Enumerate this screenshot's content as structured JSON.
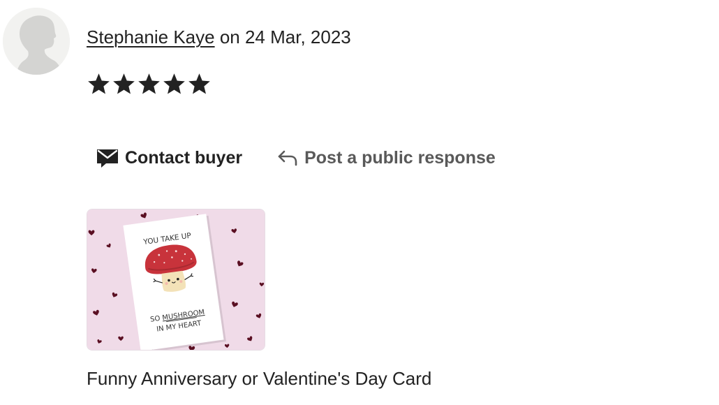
{
  "review": {
    "avatar_icon": "default-avatar-silhouette-icon",
    "reviewer_name": "Stephanie Kaye",
    "date_prefix": " on ",
    "date": "24 Mar, 2023",
    "rating": 5,
    "max_rating": 5,
    "star_color": "#222222"
  },
  "actions": {
    "contact": {
      "label": "Contact buyer",
      "icon": "envelope-icon"
    },
    "respond": {
      "label": "Post a public response",
      "icon": "reply-arrow-icon"
    }
  },
  "listing": {
    "title": "Funny Anniversary or Valentine's Day Card",
    "card_text_top": "YOU TAKE UP",
    "card_text_line1_prefix": "SO ",
    "card_text_line1_emphasis": "MUSHROOM",
    "card_text_line2": "IN MY HEART",
    "background_color": "#f0dbe8",
    "heart_color": "#5a0f22"
  }
}
